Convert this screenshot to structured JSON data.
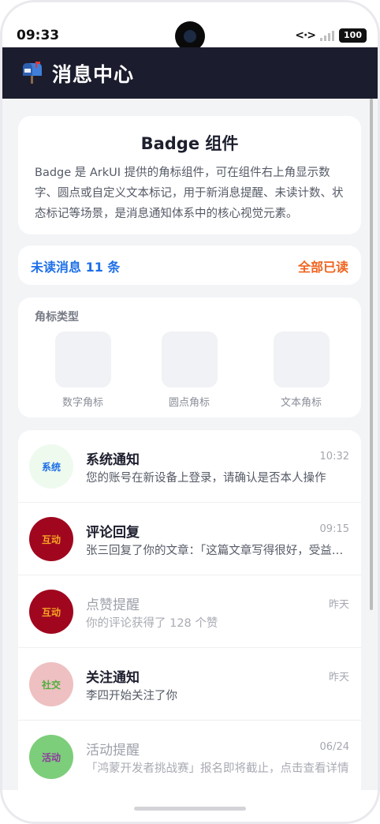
{
  "status": {
    "time": "09:33",
    "net_symbol": "<·>",
    "battery": "100"
  },
  "header": {
    "title": "消息中心",
    "icon": "mailbox-icon"
  },
  "intro": {
    "title": "Badge 组件",
    "description": "Badge 是 ArkUI 提供的角标组件，可在组件右上角显示数字、圆点或自定义文本标记，用于新消息提醒、未读计数、状态标记等场景，是消息通知体系中的核心视觉元素。"
  },
  "unread": {
    "count_label": "未读消息 11 条",
    "mark_all_label": "全部已读"
  },
  "badge_types": {
    "title": "角标类型",
    "items": [
      {
        "label": "数字角标"
      },
      {
        "label": "圆点角标"
      },
      {
        "label": "文本角标"
      }
    ]
  },
  "messages": [
    {
      "avatar": "系统",
      "title": "系统通知",
      "time": "10:32",
      "body": "您的账号在新设备上登录，请确认是否本人操作",
      "read": false,
      "avatar_bg": "#eefaee",
      "avatar_fg": "#1e6fe8"
    },
    {
      "avatar": "互动",
      "title": "评论回复",
      "time": "09:15",
      "body": "张三回复了你的文章：「这篇文章写得很好，受益匪浅」",
      "read": false,
      "avatar_bg": "#a0071f",
      "avatar_fg": "#f5a623"
    },
    {
      "avatar": "互动",
      "title": "点赞提醒",
      "time": "昨天",
      "body": "你的评论获得了 128 个赞",
      "read": true,
      "avatar_bg": "#a0071f",
      "avatar_fg": "#f5a623"
    },
    {
      "avatar": "社交",
      "title": "关注通知",
      "time": "昨天",
      "body": "李四开始关注了你",
      "read": false,
      "avatar_bg": "#eec0c2",
      "avatar_fg": "#4caf3a"
    },
    {
      "avatar": "活动",
      "title": "活动提醒",
      "time": "06/24",
      "body": "「鸿蒙开发者挑战赛」报名即将截止，点击查看详情",
      "read": true,
      "avatar_bg": "#7cce7a",
      "avatar_fg": "#8e3a9e"
    }
  ],
  "colors": {
    "appbar": "#1b1d2e",
    "accent_blue": "#1e6fe8",
    "accent_orange": "#f0631f"
  }
}
